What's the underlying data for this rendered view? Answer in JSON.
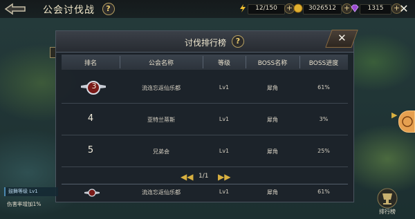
{
  "header": {
    "title": "公会讨伐战",
    "help": "?",
    "stamina": "12/150",
    "gold": "3026512",
    "gems": "1315",
    "plus": "+",
    "close": "✕"
  },
  "dialog": {
    "title": "讨伐排行榜",
    "help": "?",
    "close": "✕",
    "columns": [
      "排名",
      "公会名称",
      "等级",
      "BOSS名称",
      "BOSS进度"
    ],
    "rows": [
      {
        "rank": "3",
        "guild": "流连忘返仙乐都",
        "level": "Lv1",
        "boss": "犀角",
        "progress": "61%"
      },
      {
        "rank": "4",
        "guild": "亚特兰蒂斯",
        "level": "Lv1",
        "boss": "犀角",
        "progress": "3%"
      },
      {
        "rank": "5",
        "guild": "兄弟会",
        "level": "Lv1",
        "boss": "犀角",
        "progress": "25%"
      }
    ],
    "pager": {
      "text": "1/1",
      "prev": "◀◀",
      "next": "▶▶"
    },
    "mine": {
      "rank": "3",
      "guild": "流连忘返仙乐都",
      "level": "Lv1",
      "boss": "犀角",
      "progress": "61%"
    }
  },
  "left_info": {
    "line1": "鼓舞等级  Lv1",
    "line2": "伤害率增加1%"
  },
  "right": {
    "rank_button": "排行榜"
  },
  "colors": {
    "accent_gold": "#d8b040",
    "gem_purple": "#9a4ad0"
  }
}
